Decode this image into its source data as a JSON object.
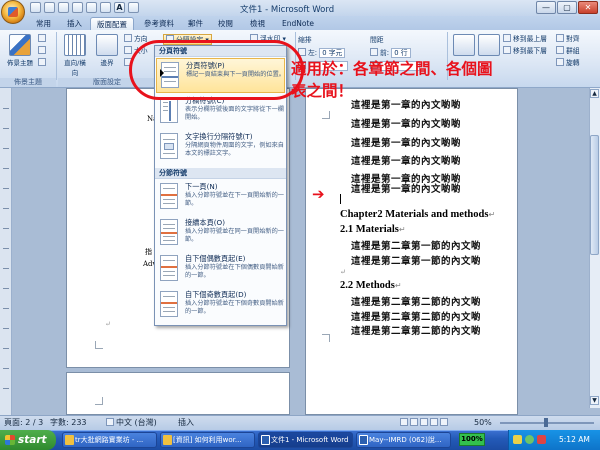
{
  "window": {
    "title": "文件1 - Microsoft Word",
    "min": "—",
    "max": "▢",
    "close": "✕"
  },
  "tabs": [
    "常用",
    "插入",
    "版面配置",
    "參考資料",
    "郵件",
    "校閱",
    "檢視",
    "EndNote"
  ],
  "active_tab": "版面配置",
  "ribbon": {
    "theme_group": {
      "label": "佈景主題",
      "button": "佈景主題"
    },
    "page_setup": {
      "label": "版面設定",
      "margins": "邊界",
      "direction": "直向/橫向",
      "orientation": "方向",
      "size": "大小",
      "breaks": "分隔設定",
      "watermark": "浮水印"
    },
    "indent": {
      "label": "縮排",
      "left_label": "左:",
      "left_value": "0 字元"
    },
    "spacing": {
      "label": "間距",
      "before_label": "前:",
      "before_value": "0 行"
    },
    "arrange": {
      "bring_front": "移到最上層",
      "send_back": "移到最下層",
      "group": "群組",
      "align": "對齊",
      "rotate": "旋轉"
    }
  },
  "breaks_menu": {
    "section_page": "分頁符號",
    "items": [
      {
        "title": "分頁符號(P)",
        "desc": "標記一頁結束與下一頁開始的位置。"
      },
      {
        "title": "分欄符號(C)",
        "desc": "表示分欄符號後面的文字將從下一欄開始。"
      },
      {
        "title": "文字換行分隔符號(T)",
        "desc": "分隔網頁物件周圍的文字，例如來自本文的標註文字。"
      }
    ],
    "section_break": "分節符號",
    "section_items": [
      {
        "title": "下一頁(N)",
        "desc": "插入分節符號並在下一頁開始新的一節。"
      },
      {
        "title": "接續本頁(O)",
        "desc": "插入分節符號並在同一頁開始新的一節。"
      },
      {
        "title": "自下個偶數頁起(E)",
        "desc": "插入分節符號並在下個偶數頁開始新的一節。"
      },
      {
        "title": "自下個奇數頁起(D)",
        "desc": "插入分節符號並在下個奇數頁開始新的一節。"
      }
    ]
  },
  "callout": {
    "line1": "適用於：各章節之間、各個圖",
    "line2": "表之間！"
  },
  "page1": {
    "frag_n": "Na",
    "frag_dao": "指",
    "frag_adv": "Adv"
  },
  "page2": {
    "lines_top": [
      "這裡是第一章的內文喲喲",
      "這裡是第一章的內文喲喲",
      "這裡是第一章的內文喲喲",
      "這裡是第一章的內文喲喲",
      "這裡是第一章的內文喲喲",
      "這裡是第一章的內文喲喲"
    ],
    "chapter2": "Chapter2 Materials and methods",
    "materials": "2.1 Materials",
    "m_lines": [
      "這裡是第二章第一節的內文喲",
      "這裡是第二章第一節的內文喲"
    ],
    "methods": "2.2 Methods",
    "me_lines": [
      "這裡是第二章第二節的內文喲",
      "這裡是第二章第二節的內文喲",
      "這裡是第二章第二節的內文喲"
    ],
    "para_mark": "↵"
  },
  "status": {
    "page": "頁面: 2 / 3",
    "words": "字數: 233",
    "lang": "中文 (台灣)",
    "mode": "插入",
    "zoom": "50%"
  },
  "taskbar": {
    "start": "start",
    "items": [
      {
        "label": "tr大批網路實業坊 - ...",
        "color": "#f0c040"
      },
      {
        "label": "[資訊] 如何利用wor...",
        "color": "#f0c040"
      },
      {
        "label": "文件1 - Microsoft Word",
        "color": "#2b5fb0"
      },
      {
        "label": "May--IMRD (062)說...",
        "color": "#2b5fb0"
      }
    ],
    "battery": "100%",
    "time": "5:12 AM"
  },
  "colors": {
    "callout": "#e8121c",
    "accent": "#153c6b"
  }
}
